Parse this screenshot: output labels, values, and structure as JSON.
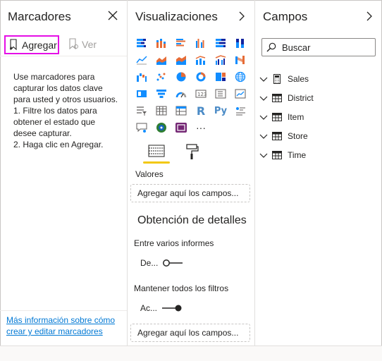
{
  "bookmarks": {
    "title": "Marcadores",
    "add_label": "Agregar",
    "view_label": "Ver",
    "help_lines": [
      "Use marcadores para capturar los datos clave para usted y otros usuarios.",
      "1. Filtre los datos para obtener el estado que desee capturar.",
      "2. Haga clic en Agregar."
    ],
    "link_text": "Más información sobre cómo crear y editar marcadores"
  },
  "visualizations": {
    "title": "Visualizaciones",
    "values_label": "Valores",
    "values_placeholder": "Agregar aquí los campos...",
    "drillthrough_title": "Obtención de detalles",
    "cross_report_label": "Entre varios informes",
    "cross_report_toggle": "De...",
    "keep_filters_label": "Mantener todos los filtros",
    "keep_filters_toggle": "Ac...",
    "drill_placeholder": "Agregar aquí los campos...",
    "more_label": "···"
  },
  "fields": {
    "title": "Campos",
    "search_placeholder": "Buscar",
    "tables": [
      {
        "name": "Sales",
        "icon": "calculator-icon"
      },
      {
        "name": "District",
        "icon": "table-icon"
      },
      {
        "name": "Item",
        "icon": "table-icon"
      },
      {
        "name": "Store",
        "icon": "table-icon"
      },
      {
        "name": "Time",
        "icon": "table-icon"
      }
    ]
  },
  "colors": {
    "highlight": "#e50fe6",
    "accent_yellow": "#f2c811",
    "link": "#0078d4"
  }
}
